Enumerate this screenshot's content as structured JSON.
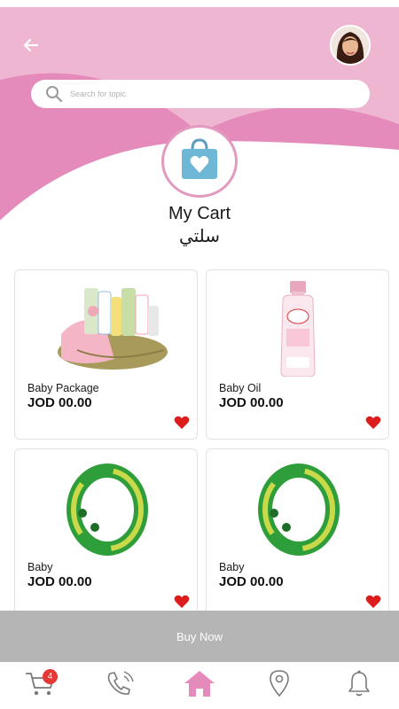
{
  "header": {
    "search_placeholder": "Search for topic",
    "title": "My Cart",
    "title_ar": "سلتي"
  },
  "colors": {
    "pink_light": "#f0b9d3",
    "pink_dark": "#e081b2",
    "bag_blue": "#6fb7d6",
    "heart_red": "#dd1c1c",
    "buy_now_bg": "#b5b5b5"
  },
  "products": [
    {
      "name": "Baby Package",
      "price": "JOD 00.00",
      "image": "baby-package-basket"
    },
    {
      "name": "Baby Oil",
      "price": "JOD 00.00",
      "image": "baby-oil-bottle"
    },
    {
      "name": "Baby",
      "price": "JOD 00.00",
      "image": "green-bracelet"
    },
    {
      "name": "Baby",
      "price": "JOD 00.00",
      "image": "green-bracelet"
    }
  ],
  "buy_now_label": "Buy Now",
  "tabs": {
    "cart_badge": "4",
    "items": [
      "cart-icon",
      "phone-icon",
      "home-icon",
      "location-icon",
      "bell-icon"
    ],
    "active": "home-icon"
  }
}
